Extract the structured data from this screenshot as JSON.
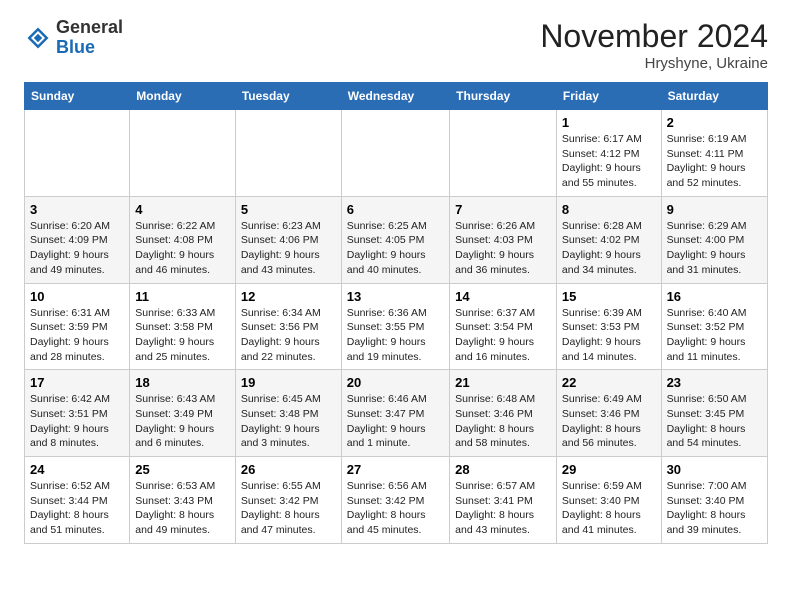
{
  "header": {
    "logo_general": "General",
    "logo_blue": "Blue",
    "month_title": "November 2024",
    "location": "Hryshyne, Ukraine"
  },
  "weekdays": [
    "Sunday",
    "Monday",
    "Tuesday",
    "Wednesday",
    "Thursday",
    "Friday",
    "Saturday"
  ],
  "weeks": [
    [
      {
        "day": "",
        "info": ""
      },
      {
        "day": "",
        "info": ""
      },
      {
        "day": "",
        "info": ""
      },
      {
        "day": "",
        "info": ""
      },
      {
        "day": "",
        "info": ""
      },
      {
        "day": "1",
        "info": "Sunrise: 6:17 AM\nSunset: 4:12 PM\nDaylight: 9 hours and 55 minutes."
      },
      {
        "day": "2",
        "info": "Sunrise: 6:19 AM\nSunset: 4:11 PM\nDaylight: 9 hours and 52 minutes."
      }
    ],
    [
      {
        "day": "3",
        "info": "Sunrise: 6:20 AM\nSunset: 4:09 PM\nDaylight: 9 hours and 49 minutes."
      },
      {
        "day": "4",
        "info": "Sunrise: 6:22 AM\nSunset: 4:08 PM\nDaylight: 9 hours and 46 minutes."
      },
      {
        "day": "5",
        "info": "Sunrise: 6:23 AM\nSunset: 4:06 PM\nDaylight: 9 hours and 43 minutes."
      },
      {
        "day": "6",
        "info": "Sunrise: 6:25 AM\nSunset: 4:05 PM\nDaylight: 9 hours and 40 minutes."
      },
      {
        "day": "7",
        "info": "Sunrise: 6:26 AM\nSunset: 4:03 PM\nDaylight: 9 hours and 36 minutes."
      },
      {
        "day": "8",
        "info": "Sunrise: 6:28 AM\nSunset: 4:02 PM\nDaylight: 9 hours and 34 minutes."
      },
      {
        "day": "9",
        "info": "Sunrise: 6:29 AM\nSunset: 4:00 PM\nDaylight: 9 hours and 31 minutes."
      }
    ],
    [
      {
        "day": "10",
        "info": "Sunrise: 6:31 AM\nSunset: 3:59 PM\nDaylight: 9 hours and 28 minutes."
      },
      {
        "day": "11",
        "info": "Sunrise: 6:33 AM\nSunset: 3:58 PM\nDaylight: 9 hours and 25 minutes."
      },
      {
        "day": "12",
        "info": "Sunrise: 6:34 AM\nSunset: 3:56 PM\nDaylight: 9 hours and 22 minutes."
      },
      {
        "day": "13",
        "info": "Sunrise: 6:36 AM\nSunset: 3:55 PM\nDaylight: 9 hours and 19 minutes."
      },
      {
        "day": "14",
        "info": "Sunrise: 6:37 AM\nSunset: 3:54 PM\nDaylight: 9 hours and 16 minutes."
      },
      {
        "day": "15",
        "info": "Sunrise: 6:39 AM\nSunset: 3:53 PM\nDaylight: 9 hours and 14 minutes."
      },
      {
        "day": "16",
        "info": "Sunrise: 6:40 AM\nSunset: 3:52 PM\nDaylight: 9 hours and 11 minutes."
      }
    ],
    [
      {
        "day": "17",
        "info": "Sunrise: 6:42 AM\nSunset: 3:51 PM\nDaylight: 9 hours and 8 minutes."
      },
      {
        "day": "18",
        "info": "Sunrise: 6:43 AM\nSunset: 3:49 PM\nDaylight: 9 hours and 6 minutes."
      },
      {
        "day": "19",
        "info": "Sunrise: 6:45 AM\nSunset: 3:48 PM\nDaylight: 9 hours and 3 minutes."
      },
      {
        "day": "20",
        "info": "Sunrise: 6:46 AM\nSunset: 3:47 PM\nDaylight: 9 hours and 1 minute."
      },
      {
        "day": "21",
        "info": "Sunrise: 6:48 AM\nSunset: 3:46 PM\nDaylight: 8 hours and 58 minutes."
      },
      {
        "day": "22",
        "info": "Sunrise: 6:49 AM\nSunset: 3:46 PM\nDaylight: 8 hours and 56 minutes."
      },
      {
        "day": "23",
        "info": "Sunrise: 6:50 AM\nSunset: 3:45 PM\nDaylight: 8 hours and 54 minutes."
      }
    ],
    [
      {
        "day": "24",
        "info": "Sunrise: 6:52 AM\nSunset: 3:44 PM\nDaylight: 8 hours and 51 minutes."
      },
      {
        "day": "25",
        "info": "Sunrise: 6:53 AM\nSunset: 3:43 PM\nDaylight: 8 hours and 49 minutes."
      },
      {
        "day": "26",
        "info": "Sunrise: 6:55 AM\nSunset: 3:42 PM\nDaylight: 8 hours and 47 minutes."
      },
      {
        "day": "27",
        "info": "Sunrise: 6:56 AM\nSunset: 3:42 PM\nDaylight: 8 hours and 45 minutes."
      },
      {
        "day": "28",
        "info": "Sunrise: 6:57 AM\nSunset: 3:41 PM\nDaylight: 8 hours and 43 minutes."
      },
      {
        "day": "29",
        "info": "Sunrise: 6:59 AM\nSunset: 3:40 PM\nDaylight: 8 hours and 41 minutes."
      },
      {
        "day": "30",
        "info": "Sunrise: 7:00 AM\nSunset: 3:40 PM\nDaylight: 8 hours and 39 minutes."
      }
    ]
  ]
}
